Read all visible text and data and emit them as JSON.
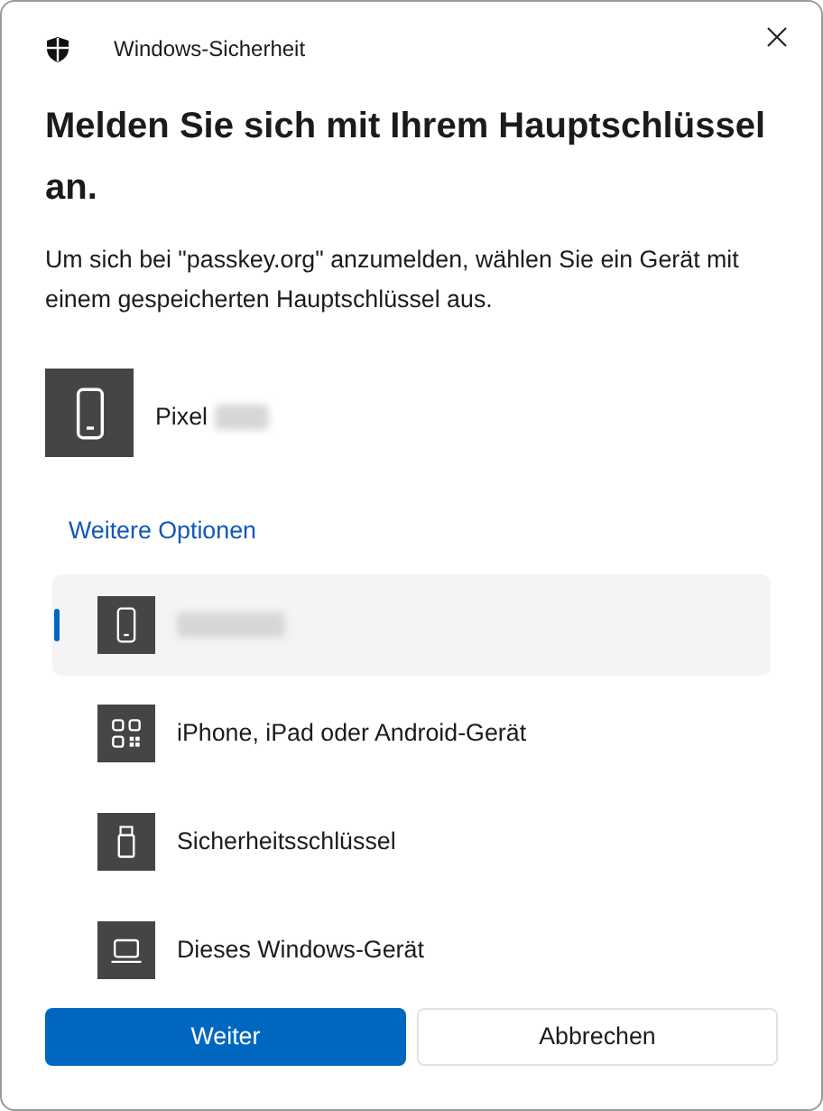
{
  "window": {
    "title": "Windows-Sicherheit"
  },
  "heading": "Melden Sie sich mit Ihrem Hauptschlüssel an.",
  "description": "Um sich bei \"passkey.org\" anzumelden, wählen Sie ein Gerät mit einem gespeicherten Hauptschlüssel aus.",
  "device": {
    "kind": "phone",
    "name": "Pixel",
    "redacted": true
  },
  "more_options_link": "Weitere Optionen",
  "options": [
    {
      "kind": "phone",
      "redacted": true,
      "selected": true
    },
    {
      "kind": "qr",
      "label": "iPhone, iPad oder Android-Gerät",
      "selected": false
    },
    {
      "kind": "usb",
      "label": "Sicherheitsschlüssel",
      "selected": false
    },
    {
      "kind": "laptop",
      "label": "Dieses Windows-Gerät",
      "selected": false
    }
  ],
  "buttons": [
    {
      "label": "Weiter",
      "kind": "primary"
    },
    {
      "label": "Abbrechen",
      "kind": "secondary"
    }
  ]
}
